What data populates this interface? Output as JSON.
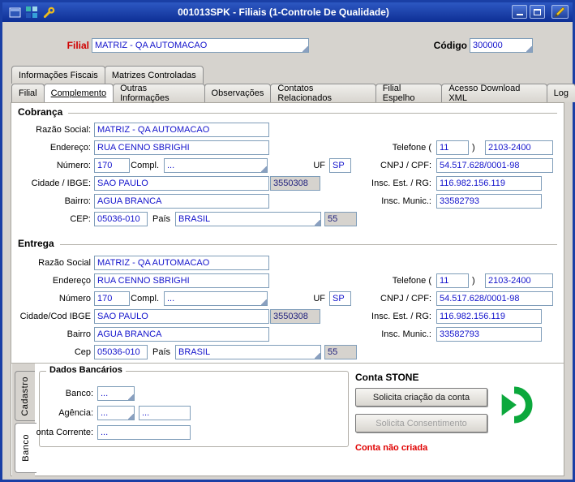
{
  "window": {
    "title": "001013SPK - Filiais (1-Controle De Qualidade)"
  },
  "header": {
    "filial_label": "Filial",
    "filial_value": "MATRIZ - QA AUTOMACAO",
    "codigo_label": "Código",
    "codigo_value": "300000"
  },
  "folder_tabs": {
    "row1": [
      {
        "label": "Informações Fiscais"
      },
      {
        "label": "Matrizes Controladas"
      }
    ],
    "row2": [
      {
        "label": "Filial"
      },
      {
        "label": "Complemento"
      },
      {
        "label": "Outras Informações"
      },
      {
        "label": "Observações"
      },
      {
        "label": "Contatos Relacionados"
      },
      {
        "label": "Filial Espelho"
      },
      {
        "label": "Acesso Download XML"
      },
      {
        "label": "Log"
      }
    ]
  },
  "cobranca": {
    "title": "Cobrança",
    "razao_social": {
      "label": "Razão Social:",
      "value": "MATRIZ - QA AUTOMACAO"
    },
    "endereco": {
      "label": "Endereço:",
      "value": "RUA CENNO SBRIGHI"
    },
    "numero": {
      "label": "Número:",
      "value": "170"
    },
    "compl": {
      "label": "Compl.",
      "value": "..."
    },
    "uf": {
      "label": "UF",
      "value": "SP"
    },
    "cidade": {
      "label": "Cidade / IBGE:",
      "value": "SAO PAULO"
    },
    "ibge": "3550308",
    "bairro": {
      "label": "Bairro:",
      "value": "AGUA BRANCA"
    },
    "cep": {
      "label": "CEP:",
      "value": "05036-010"
    },
    "pais": {
      "label": "País",
      "value": "BRASIL"
    },
    "ddi": "55",
    "telefone": {
      "label": "Telefone (",
      "ddd": "11",
      "close": ")",
      "value": "2103-2400"
    },
    "cnpj": {
      "label": "CNPJ / CPF:",
      "value": "54.517.628/0001-98"
    },
    "insc_est": {
      "label": "Insc. Est. / RG:",
      "value": "116.982.156.119"
    },
    "insc_mun": {
      "label": "Insc. Munic.:",
      "value": "33582793"
    }
  },
  "entrega": {
    "title": "Entrega",
    "razao_social": {
      "label": "Razão Social",
      "value": "MATRIZ - QA AUTOMACAO"
    },
    "endereco": {
      "label": "Endereço",
      "value": "RUA CENNO SBRIGHI"
    },
    "numero": {
      "label": "Número",
      "value": "170"
    },
    "compl": {
      "label": "Compl.",
      "value": "..."
    },
    "uf": {
      "label": "UF",
      "value": "SP"
    },
    "cidade": {
      "label": "Cidade/Cod IBGE",
      "value": "SAO PAULO"
    },
    "ibge": "3550308",
    "bairro": {
      "label": "Bairro",
      "value": "AGUA BRANCA"
    },
    "cep": {
      "label": "Cep",
      "value": "05036-010"
    },
    "pais": {
      "label": "País",
      "value": "BRASIL"
    },
    "ddi": "55",
    "telefone": {
      "label": "Telefone (",
      "ddd": "11",
      "close": ")",
      "value": "2103-2400"
    },
    "cnpj": {
      "label": "CNPJ / CPF:",
      "value": "54.517.628/0001-98"
    },
    "insc_est": {
      "label": "Insc. Est. / RG:",
      "value": "116.982.156.119"
    },
    "insc_mun": {
      "label": "Insc. Munic.:",
      "value": "33582793"
    }
  },
  "side_tabs": [
    {
      "label": "Cadastro"
    },
    {
      "label": "Banco"
    }
  ],
  "dados_bancarios": {
    "title": "Dados Bancários",
    "banco": {
      "label": "Banco:",
      "value": "..."
    },
    "agencia": {
      "label": "Agência:",
      "value": "...",
      "value2": "..."
    },
    "conta_corrente": {
      "label": "Conta Corrente:",
      "value": "..."
    }
  },
  "conta_stone": {
    "title": "Conta STONE",
    "criar_button": "Solicita criação da conta",
    "consentimento_button": "Solicita Consentimento",
    "status": "Conta não criada"
  }
}
